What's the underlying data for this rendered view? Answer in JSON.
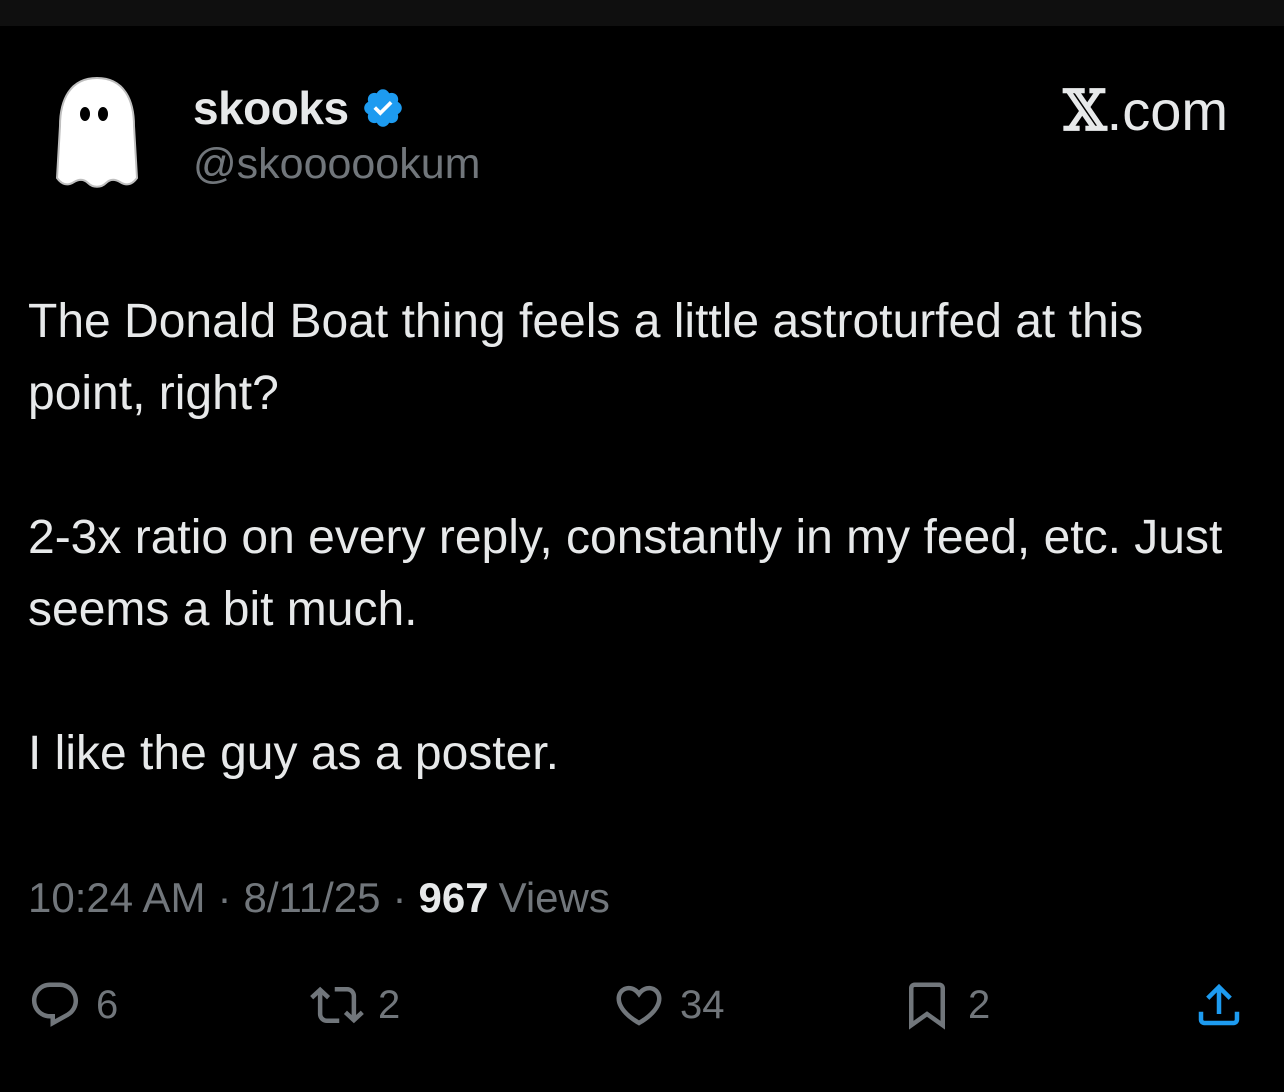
{
  "author": {
    "display_name": "skooks",
    "handle": "@skoooookum",
    "verified": true
  },
  "site": {
    "label_x": "𝕏",
    "label_rest": ".com"
  },
  "tweet": {
    "paragraphs": [
      "The Donald Boat thing feels a little astroturfed at this point, right?",
      "2-3x ratio on every reply, constantly in my feed, etc. Just seems a bit much.",
      "I like the guy as a poster."
    ],
    "time": "10:24 AM",
    "separator": "·",
    "date": "8/11/25",
    "views_count": "967",
    "views_label": "Views"
  },
  "actions": {
    "replies": "6",
    "retweets": "2",
    "likes": "34",
    "bookmarks": "2"
  },
  "colors": {
    "background": "#000000",
    "text": "#e7e9ea",
    "muted": "#71767b",
    "verified_blue": "#1d9bf0"
  }
}
